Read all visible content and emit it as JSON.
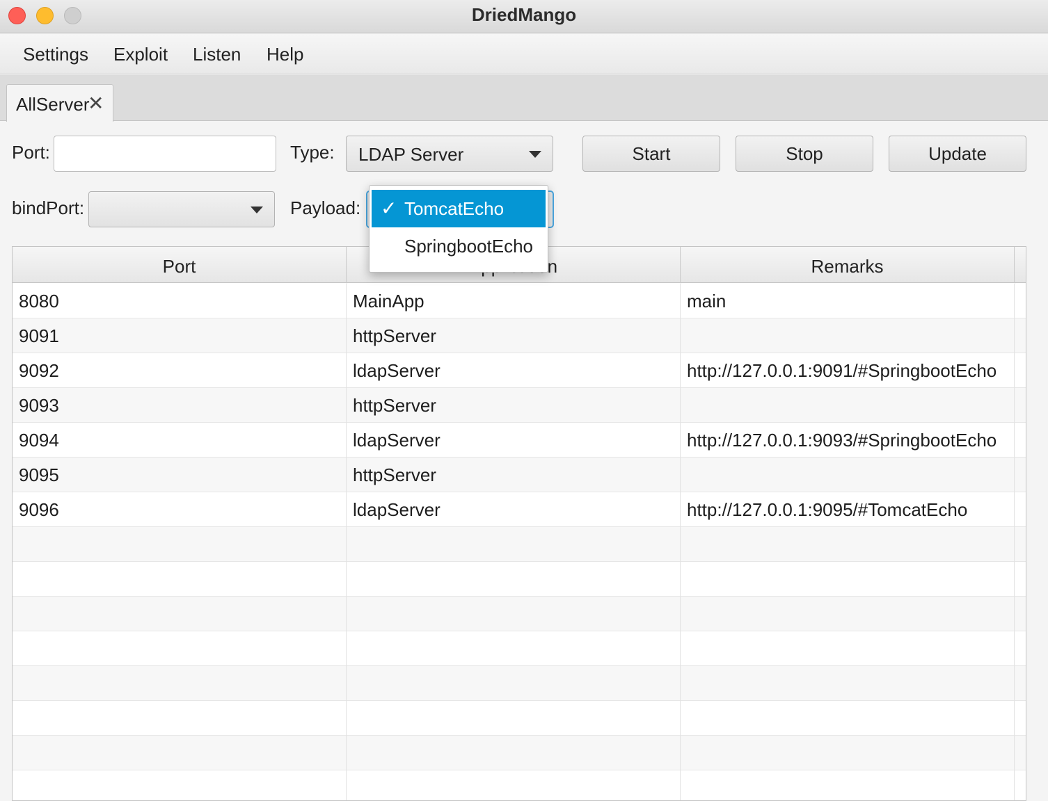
{
  "window": {
    "title": "DriedMango"
  },
  "menu": {
    "items": [
      "Settings",
      "Exploit",
      "Listen",
      "Help"
    ]
  },
  "tabs": [
    {
      "label": "AllServer",
      "close": "✕"
    }
  ],
  "form": {
    "port_label": "Port:",
    "port_value": "",
    "type_label": "Type:",
    "type_value": "LDAP Server",
    "bindport_label": "bindPort:",
    "bindport_value": "",
    "payload_label": "Payload:",
    "payload_options": [
      "TomcatEcho",
      "SpringbootEcho"
    ],
    "payload_selected": "TomcatEcho",
    "check_glyph": "✓"
  },
  "buttons": {
    "start": "Start",
    "stop": "Stop",
    "update": "Update"
  },
  "table": {
    "headers": [
      "Port",
      "Application",
      "Remarks"
    ],
    "rows": [
      [
        "8080",
        "MainApp",
        "main"
      ],
      [
        "9091",
        "httpServer",
        ""
      ],
      [
        "9092",
        "ldapServer",
        "http://127.0.0.1:9091/#SpringbootEcho"
      ],
      [
        "9093",
        "httpServer",
        ""
      ],
      [
        "9094",
        "ldapServer",
        "http://127.0.0.1:9093/#SpringbootEcho"
      ],
      [
        "9095",
        "httpServer",
        ""
      ],
      [
        "9096",
        "ldapServer",
        "http://127.0.0.1:9095/#TomcatEcho"
      ]
    ],
    "empty_rows": 8
  },
  "colors": {
    "selection": "#0596d4",
    "close": "#fe5f57",
    "minimize": "#febc2e",
    "maximize": "#cfcfcf"
  }
}
